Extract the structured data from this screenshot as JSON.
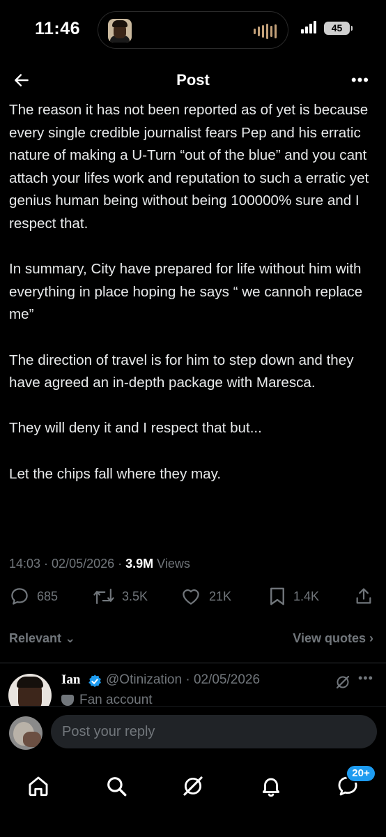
{
  "status_bar": {
    "time": "11:46",
    "battery": "45"
  },
  "header": {
    "title": "Post"
  },
  "post": {
    "paragraphs": [
      "The reason it has not been reported as of yet is because every single credible journalist fears Pep and his erratic nature of making a U-Turn “out of the blue” and you cant attach your lifes work and reputation to such a erratic yet genius human being without being 100000% sure and I respect that.",
      "In summary, City have prepared for life without him with everything in place hoping he says “ we cannoh replace me”",
      "The direction of travel is for him to step down and they have agreed an in-depth package with Maresca.",
      "They will deny it and I respect that but...",
      "Let the chips fall where they may."
    ],
    "timestamp": "14:03 · 02/05/2026 · ",
    "views_count": "3.9M",
    "views_label": " Views"
  },
  "actions": {
    "replies": "685",
    "reposts": "3.5K",
    "likes": "21K",
    "bookmarks": "1.4K"
  },
  "sort": {
    "label": "Relevant",
    "view_quotes": "View quotes"
  },
  "reply_preview": {
    "name": "Ian",
    "handle_date": "@Otinization · 02/05/2026",
    "label": "Fan account"
  },
  "composer": {
    "placeholder": "Post your reply"
  },
  "tabbar": {
    "messages_badge": "20+"
  },
  "colors": {
    "accent": "#1d9bf0",
    "background": "#000000",
    "muted": "#71767b"
  }
}
